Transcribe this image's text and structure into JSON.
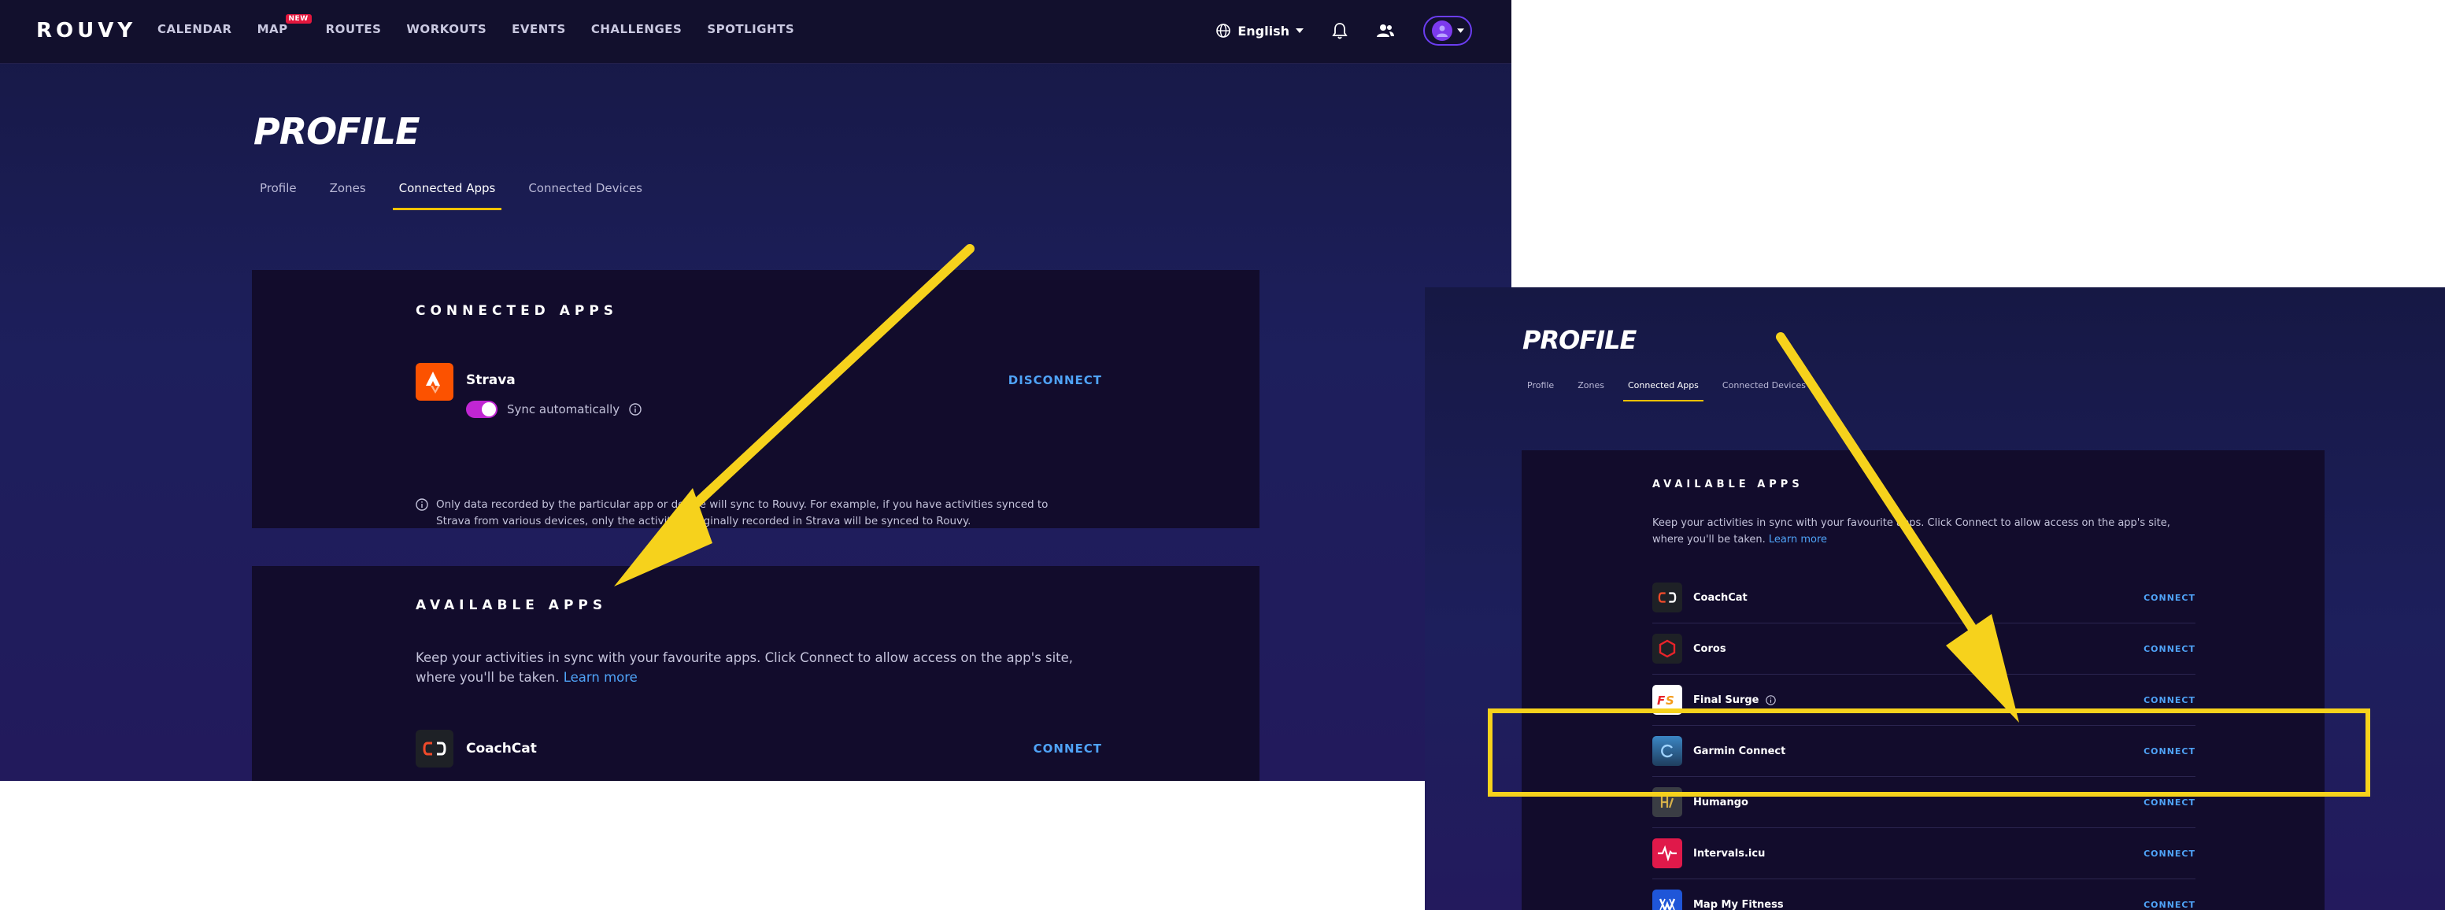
{
  "brand": {
    "logo": "ROUVY",
    "accent": "#f3c200"
  },
  "nav": {
    "items": [
      {
        "label": "CALENDAR"
      },
      {
        "label": "MAP",
        "badge": "NEW"
      },
      {
        "label": "ROUTES"
      },
      {
        "label": "WORKOUTS"
      },
      {
        "label": "EVENTS"
      },
      {
        "label": "CHALLENGES"
      },
      {
        "label": "SPOTLIGHTS"
      }
    ],
    "language": "English"
  },
  "page": {
    "title": "PROFILE",
    "tabs": [
      {
        "label": "Profile"
      },
      {
        "label": "Zones"
      },
      {
        "label": "Connected Apps"
      },
      {
        "label": "Connected Devices"
      }
    ],
    "active_tab": "Connected Apps"
  },
  "connected_apps": {
    "title": "CONNECTED APPS",
    "app": {
      "name": "Strava",
      "action": "DISCONNECT",
      "sync_label": "Sync automatically",
      "sync_enabled": true
    },
    "note_line1": "Only data recorded by the particular app or device will sync to Rouvy. For example, if you have activities synced to",
    "note_line2": "Strava from various devices, only the activities originally recorded in Strava will be synced to Rouvy."
  },
  "available_apps": {
    "title": "AVAILABLE APPS",
    "desc_line1": "Keep your activities in sync with your favourite apps. Click Connect to allow access on the app's site,",
    "desc_line2": "where you'll be taken.",
    "learn_more": "Learn more",
    "connect_label": "CONNECT",
    "apps": [
      {
        "name": "CoachCat",
        "icon": "coachcat-icon",
        "color": "#1e2126"
      },
      {
        "name": "Coros",
        "icon": "coros-icon",
        "color": "#1e2126"
      },
      {
        "name": "Final Surge",
        "icon": "final-surge-icon",
        "color": "#ffffff",
        "info": true
      },
      {
        "name": "Garmin Connect",
        "icon": "garmin-connect-icon",
        "color": "#2b5c8a"
      },
      {
        "name": "Humango",
        "icon": "humango-icon",
        "color": "#3a3d44"
      },
      {
        "name": "Intervals.icu",
        "icon": "intervals-icu-icon",
        "color": "#e0194a"
      },
      {
        "name": "Map My Fitness",
        "icon": "map-my-fitness-icon",
        "color": "#1f56d8"
      }
    ]
  },
  "highlight": {
    "target": "Garmin Connect",
    "color": "#f6d21c"
  }
}
